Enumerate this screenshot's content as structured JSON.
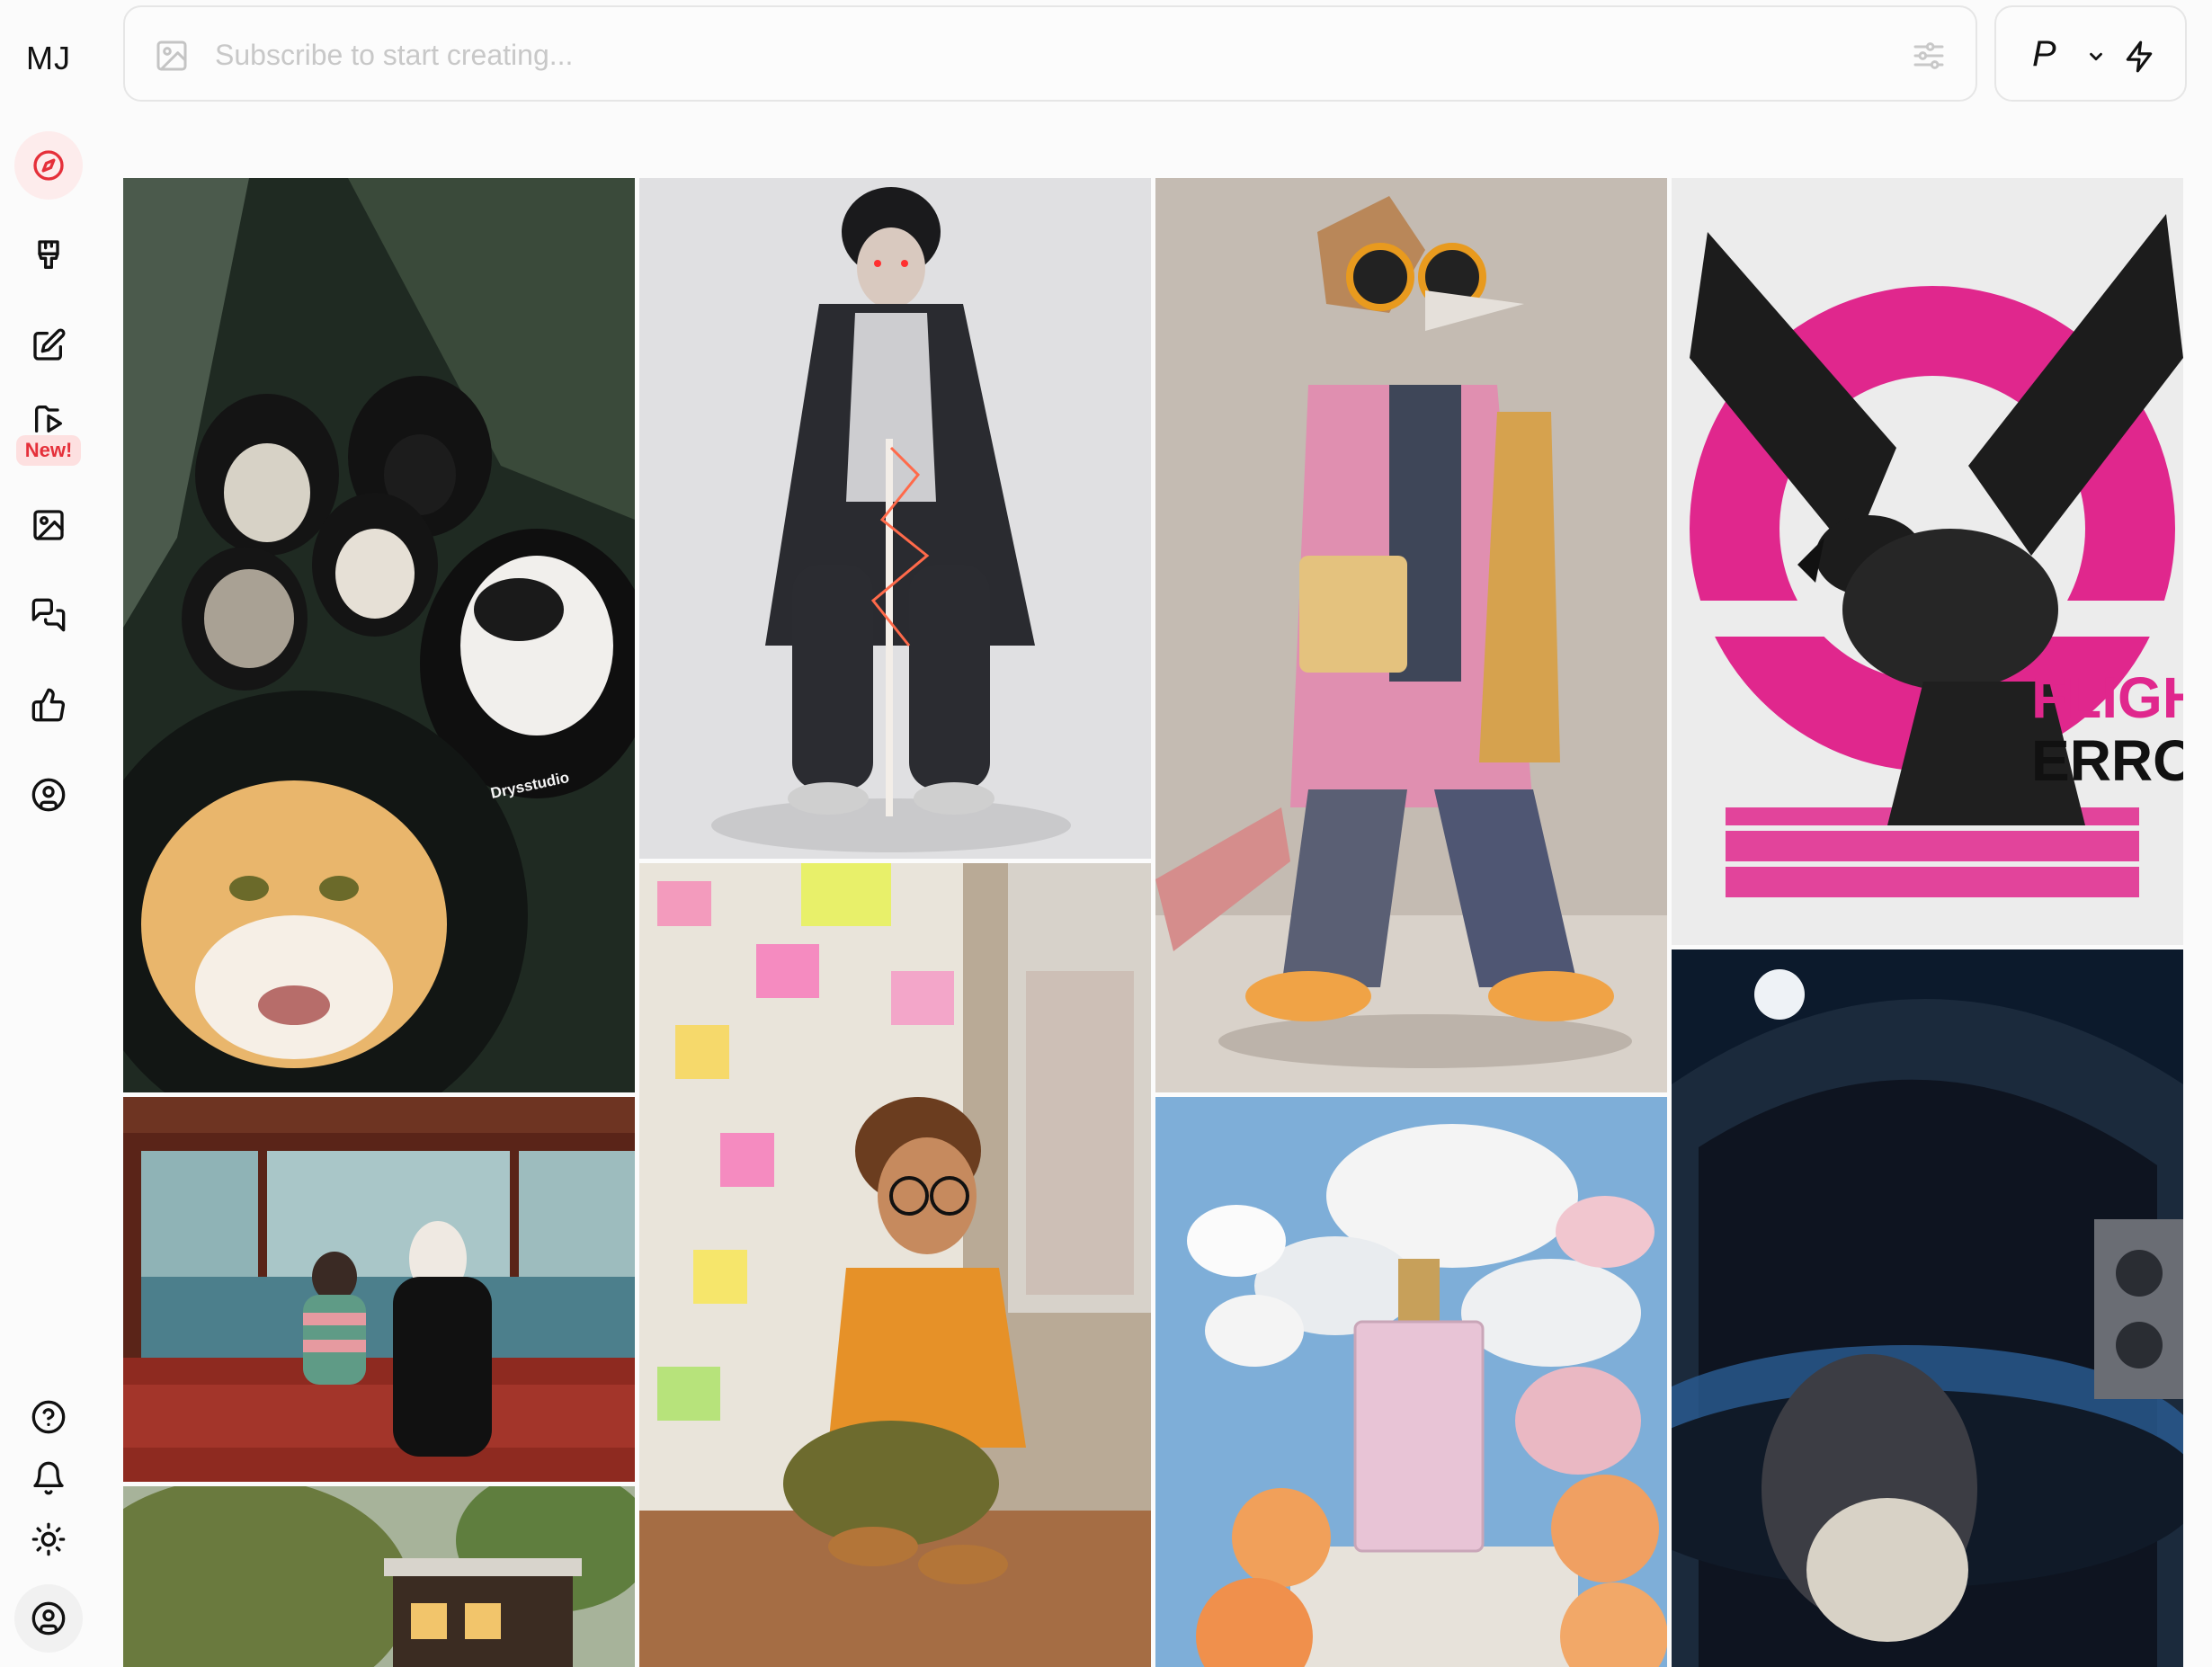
{
  "app": {
    "logo": "MJ"
  },
  "sidebar": {
    "items": [
      {
        "name": "explore",
        "icon": "compass-icon",
        "active": true
      },
      {
        "name": "create",
        "icon": "paintbrush-icon"
      },
      {
        "name": "edit",
        "icon": "edit-icon"
      },
      {
        "name": "new-feature",
        "icon": "folder-play-icon",
        "badge": "New!"
      },
      {
        "name": "organize",
        "icon": "image-icon"
      },
      {
        "name": "chat",
        "icon": "chat-bubbles-icon"
      },
      {
        "name": "tasks",
        "icon": "thumbs-up-icon"
      },
      {
        "name": "profile",
        "icon": "user-circle-icon"
      }
    ],
    "bottom": [
      {
        "name": "help",
        "icon": "help-circle-icon"
      },
      {
        "name": "notifications",
        "icon": "bell-icon"
      },
      {
        "name": "theme",
        "icon": "sun-icon"
      },
      {
        "name": "account",
        "icon": "user-circle-icon"
      }
    ]
  },
  "prompt": {
    "placeholder": "Subscribe to start creating..."
  },
  "mode": {
    "label": "P"
  },
  "colors": {
    "accent": "#e5303a",
    "active_bg": "#fdecec",
    "badge_bg": "#fde0e0"
  },
  "gallery": [
    {
      "name": "cats-in-hoodies",
      "caption": "Drysstudio"
    },
    {
      "name": "dark-warrior-lightning-sword"
    },
    {
      "name": "fox-in-fashion-outfit"
    },
    {
      "name": "glitch-bird-poster",
      "caption_1": "FLIGHT",
      "caption_2": "ERROR"
    },
    {
      "name": "girl-and-masked-figure-on-train"
    },
    {
      "name": "girl-with-sticky-notes"
    },
    {
      "name": "perfume-bottle-with-peaches"
    },
    {
      "name": "astronaut-helmet-earth-reflection"
    },
    {
      "name": "miniature-house-on-moss"
    }
  ]
}
